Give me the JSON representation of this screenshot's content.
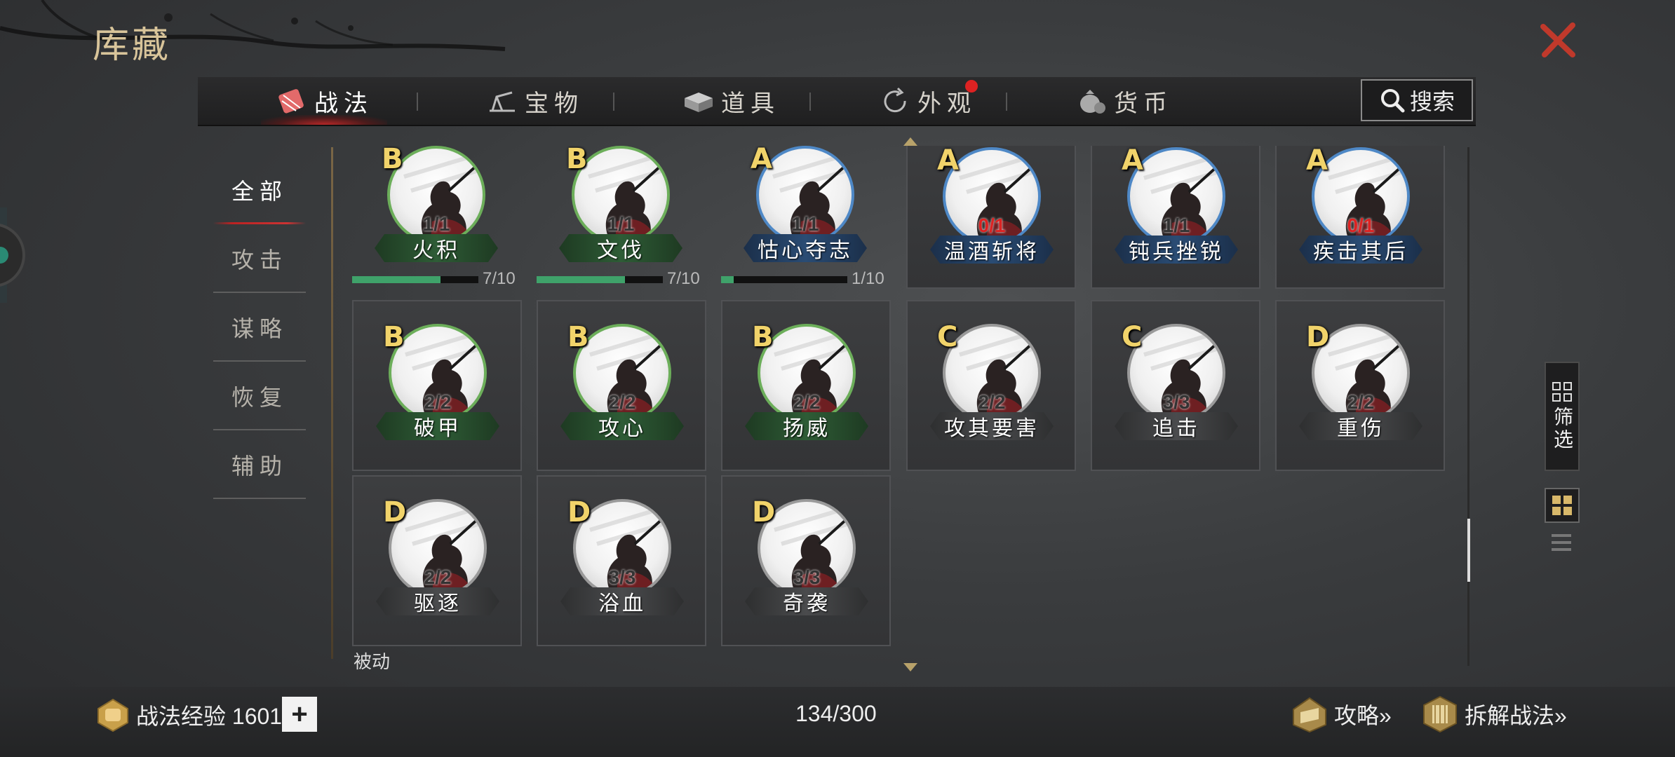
{
  "header": {
    "title": "库藏"
  },
  "tabs": [
    {
      "label": "战法",
      "active": true
    },
    {
      "label": "宝物"
    },
    {
      "label": "道具"
    },
    {
      "label": "外观",
      "badge": true
    },
    {
      "label": "货币"
    }
  ],
  "search": {
    "label": "搜索"
  },
  "categories": [
    {
      "label": "全部",
      "active": true
    },
    {
      "label": "攻击"
    },
    {
      "label": "谋略"
    },
    {
      "label": "恢复"
    },
    {
      "label": "辅助"
    }
  ],
  "cards": [
    {
      "grade": "B",
      "count": "1/1",
      "name": "火积",
      "tier": "green",
      "progress": {
        "value": 0.7,
        "text": "7/10"
      }
    },
    {
      "grade": "B",
      "count": "1/1",
      "name": "文伐",
      "tier": "green",
      "progress": {
        "value": 0.7,
        "text": "7/10"
      }
    },
    {
      "grade": "A",
      "count": "1/1",
      "name": "怙心夺志",
      "tier": "blue",
      "progress": {
        "value": 0.1,
        "text": "1/10"
      }
    },
    {
      "grade": "A",
      "count": "0/1",
      "name": "温酒斩将",
      "tier": "blue",
      "count_red": true
    },
    {
      "grade": "A",
      "count": "1/1",
      "name": "钝兵挫锐",
      "tier": "blue"
    },
    {
      "grade": "A",
      "count": "0/1",
      "name": "疾击其后",
      "tier": "blue",
      "count_red": true
    },
    {
      "grade": "B",
      "count": "2/2",
      "name": "破甲",
      "tier": "green"
    },
    {
      "grade": "B",
      "count": "2/2",
      "name": "攻心",
      "tier": "green"
    },
    {
      "grade": "B",
      "count": "2/2",
      "name": "扬威",
      "tier": "green"
    },
    {
      "grade": "C",
      "count": "2/2",
      "name": "攻其要害",
      "tier": "grey"
    },
    {
      "grade": "C",
      "count": "3/3",
      "name": "追击",
      "tier": "grey"
    },
    {
      "grade": "D",
      "count": "2/2",
      "name": "重伤",
      "tier": "grey"
    },
    {
      "grade": "D",
      "count": "2/2",
      "name": "驱逐",
      "tier": "grey"
    },
    {
      "grade": "D",
      "count": "3/3",
      "name": "浴血",
      "tier": "grey"
    },
    {
      "grade": "D",
      "count": "3/3",
      "name": "奇袭",
      "tier": "grey"
    }
  ],
  "section_next": "被动",
  "filter": {
    "label": "筛选"
  },
  "footer": {
    "exp_label": "战法经验 1601",
    "plus": "+",
    "capacity": "134/300",
    "guide_label": "攻略»",
    "dismantle_label": "拆解战法»"
  },
  "colors": {
    "accent_red": "#c62828",
    "grade_gold": "#f1d36a",
    "progress_green": "#3fa26a",
    "title_gold": "#d8c49a"
  }
}
